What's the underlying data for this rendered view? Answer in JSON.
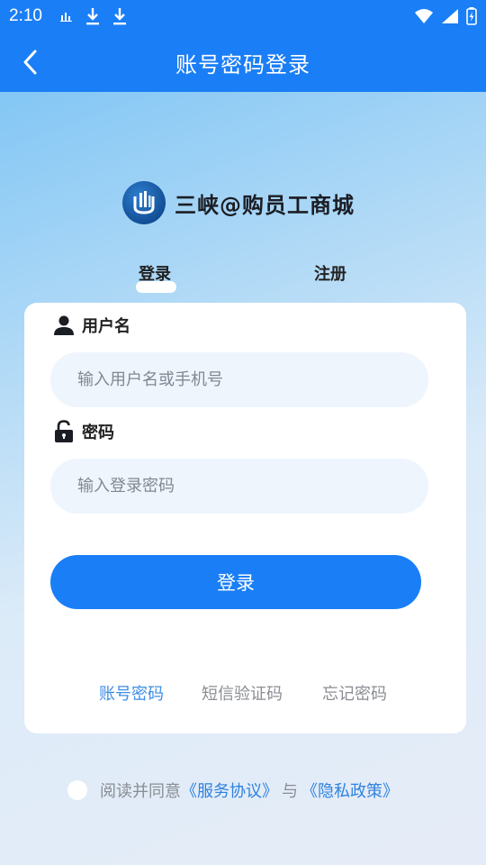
{
  "status_bar": {
    "time": "2:10",
    "icons": [
      "signal-bars-icon",
      "download-icon",
      "download-icon"
    ],
    "right_icons": [
      "wifi-icon",
      "cell-signal-icon",
      "battery-charging-icon"
    ]
  },
  "app_bar": {
    "back_icon": "back-arrow-icon",
    "title": "账号密码登录"
  },
  "brand": {
    "name": "三峡@购员工商城"
  },
  "tabs": {
    "login": "登录",
    "register": "注册"
  },
  "form": {
    "username_label": "用户名",
    "username_placeholder": "输入用户名或手机号",
    "password_label": "密码",
    "password_placeholder": "输入登录密码",
    "submit": "登录"
  },
  "modes": {
    "account": "账号密码",
    "sms": "短信验证码",
    "forgot": "忘记密码"
  },
  "agreement": {
    "prefix": "阅读并同意",
    "service": "《服务协议》",
    "and": "与",
    "privacy": "《隐私政策》"
  },
  "colors": {
    "primary": "#1a7ef6",
    "link": "#2f82de",
    "muted": "#8a8d93",
    "input_bg": "#eef5fd"
  }
}
